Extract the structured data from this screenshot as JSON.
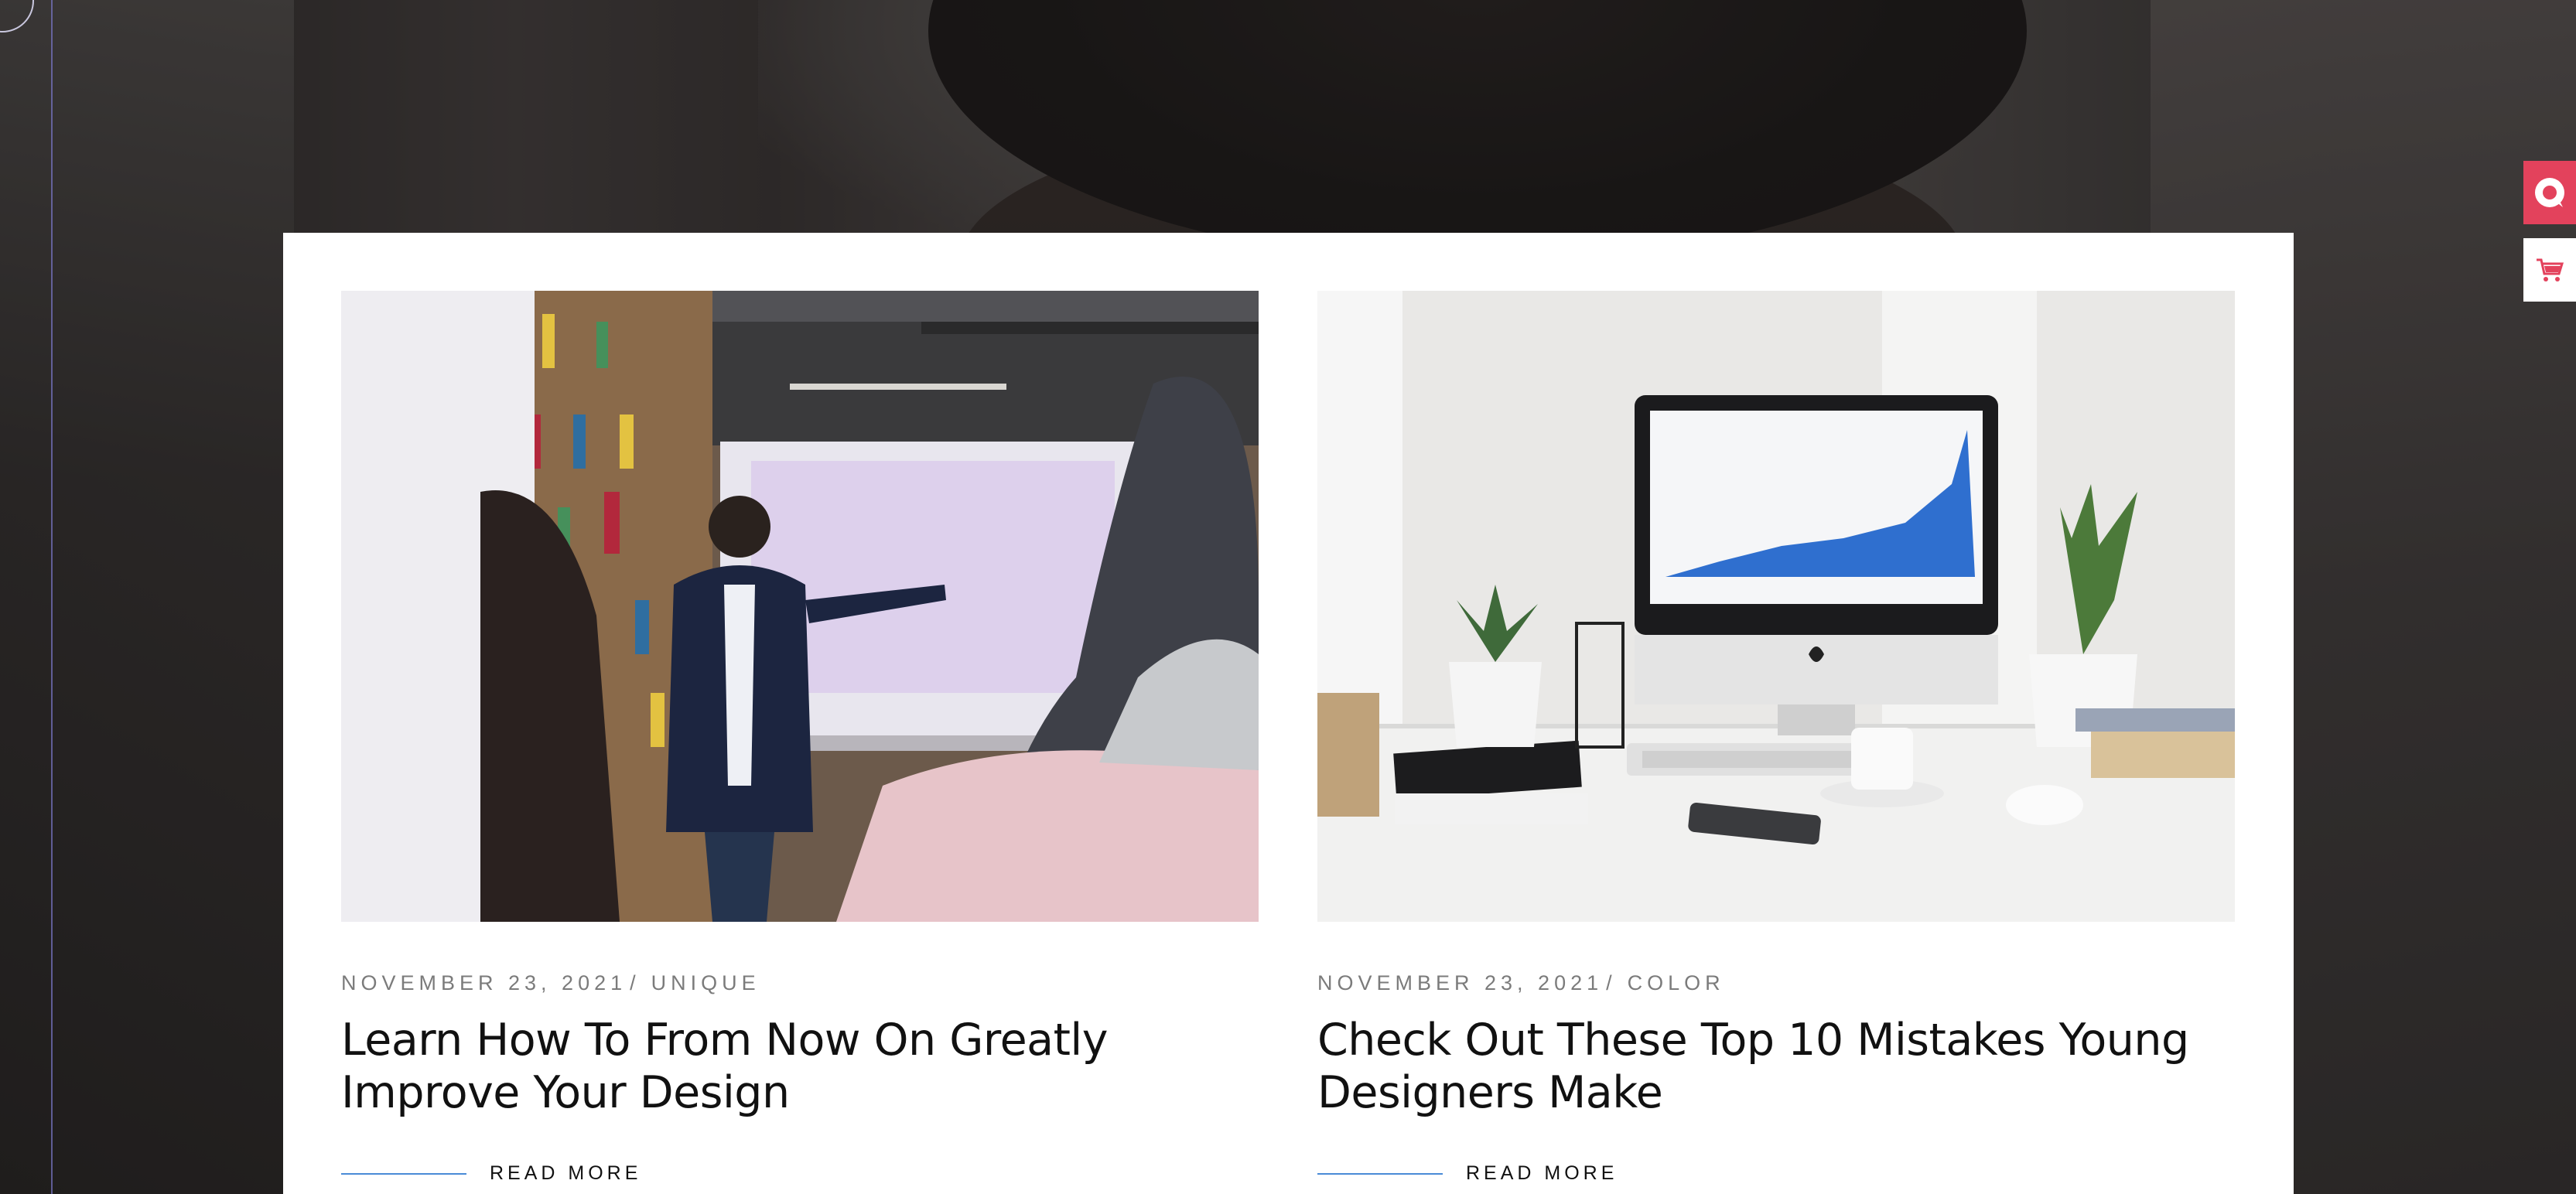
{
  "posts": [
    {
      "date": "NOVEMBER 23, 2021",
      "separator": "/",
      "category": "UNIQUE",
      "title": "Learn How To From Now On Greatly Improve Your Design",
      "read_more": "READ MORE"
    },
    {
      "date": "NOVEMBER 23, 2021",
      "separator": "/",
      "category": "COLOR",
      "title": "Check Out These Top 10 Mistakes Young Designers Make",
      "read_more": "READ MORE"
    }
  ],
  "floating": {
    "support_icon": "chat-bubble-icon",
    "cart_icon": "shopping-cart-icon"
  },
  "colors": {
    "accent_red": "#e3425c",
    "read_more_line": "#4a8bd7"
  }
}
